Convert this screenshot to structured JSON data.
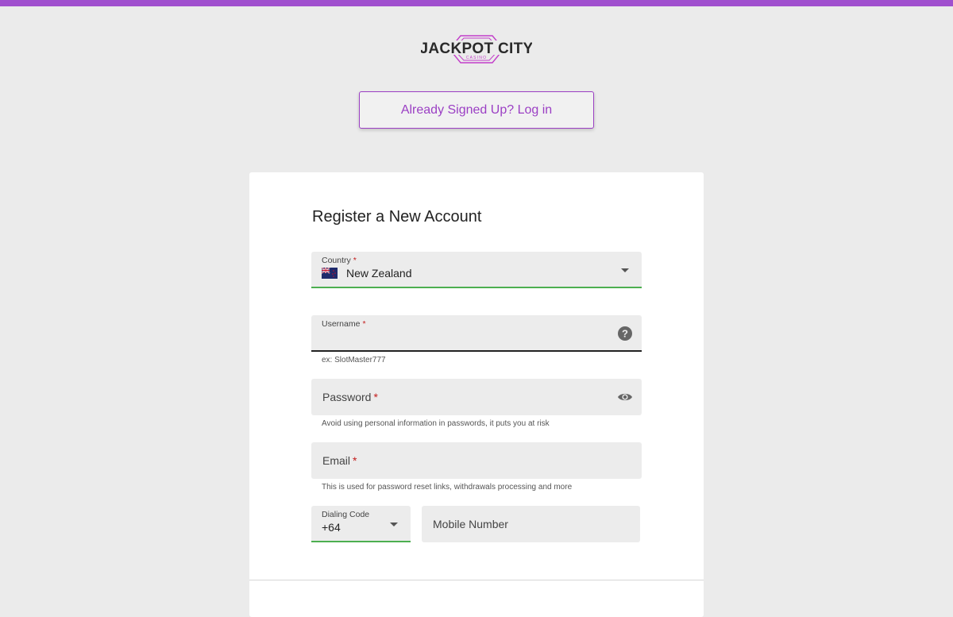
{
  "brand": {
    "name": "JACKPOT CITY",
    "subtitle": "CASINO",
    "accent_color": "#a04fce"
  },
  "login_button": {
    "label": "Already Signed Up? Log in"
  },
  "form": {
    "title": "Register a New Account",
    "country": {
      "label": "Country",
      "required": "*",
      "value": "New Zealand",
      "flag_icon": "nz-flag-icon"
    },
    "username": {
      "label": "Username",
      "required": "*",
      "helper": "ex: SlotMaster777",
      "icon": "help-icon"
    },
    "password": {
      "placeholder": "Password",
      "required": "*",
      "helper": "Avoid using personal information in passwords, it puts you at risk",
      "icon": "eye-icon"
    },
    "email": {
      "placeholder": "Email",
      "required": "*",
      "helper": "This is used for password reset links, withdrawals processing and more"
    },
    "dialing_code": {
      "label": "Dialing Code",
      "value": "+64"
    },
    "mobile": {
      "placeholder": "Mobile Number"
    }
  }
}
